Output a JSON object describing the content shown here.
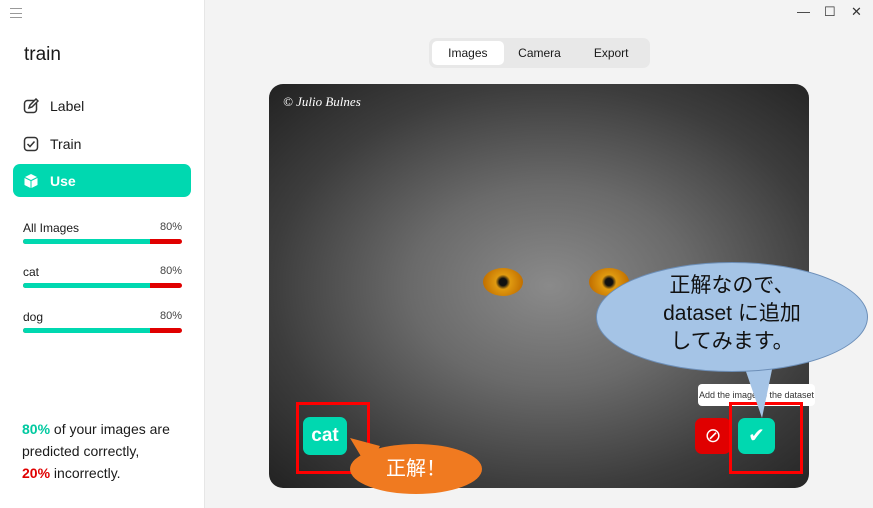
{
  "window": {
    "minimize": "—",
    "maximize": "☐",
    "close": "✕"
  },
  "sidebar": {
    "title": "train",
    "nav": [
      {
        "label": "Label",
        "icon": "edit-icon"
      },
      {
        "label": "Train",
        "icon": "checkbox-icon"
      },
      {
        "label": "Use",
        "icon": "cube-icon",
        "active": true
      }
    ],
    "stats": [
      {
        "label": "All Images",
        "pct": "80%",
        "value": 80
      },
      {
        "label": "cat",
        "pct": "80%",
        "value": 80
      },
      {
        "label": "dog",
        "pct": "80%",
        "value": 80
      }
    ],
    "summary": {
      "p1": "80%",
      "t1": " of your images are predicted correctly,",
      "p2": "20%",
      "t2": " incorrectly."
    }
  },
  "tabs": [
    "Images",
    "Camera",
    "Export"
  ],
  "image": {
    "watermark": "© Julio Bulnes",
    "prediction": "cat",
    "tooltip": "Add the image to the dataset"
  },
  "annotations": {
    "bubble_lines": [
      "正解なので、",
      "dataset に追加",
      "してみます。"
    ],
    "orange": "正解！"
  },
  "colors": {
    "accent": "#00d8b0",
    "error": "#e00000"
  }
}
